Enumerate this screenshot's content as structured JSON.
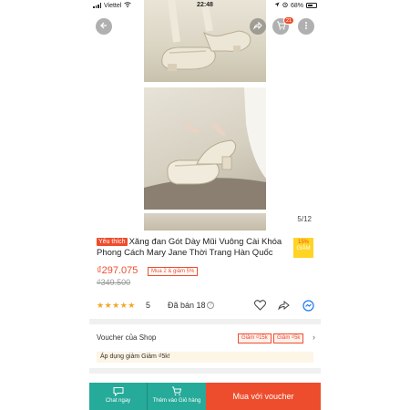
{
  "status_bar": {
    "carrier": "Viettel",
    "time": "22:48",
    "battery": "68%",
    "battery_level": 0.68
  },
  "gallery": {
    "counter": "5/12",
    "cart_count": "21"
  },
  "product": {
    "favorite_tag": "Yêu thích",
    "title": "Xăng đan Gót Dày Mũi Vuông Cài Khóa Phong Cách Mary Jane Thời Trang Hàn Quốc",
    "discount_percent": "15%",
    "discount_label": "GIẢM",
    "price": "₫297.075",
    "combo_tag": "Mua 2 & giảm 5%",
    "old_price": "₫349.500",
    "rating": "5",
    "rating_value": 5,
    "sold": "Đã bán 18"
  },
  "voucher": {
    "label": "Voucher của Shop",
    "chips": [
      "Giảm ₫15k",
      "Giảm ₫5k"
    ],
    "apply_text": "Áp dụng giảm Giảm ₫5k!"
  },
  "bottom_bar": {
    "chat_label": "Chat ngay",
    "add_cart_label": "Thêm vào Giỏ hàng",
    "buy_label": "Mua với voucher"
  },
  "colors": {
    "primary": "#ee4d2d",
    "teal": "#26aa99",
    "star": "#f5a623"
  }
}
